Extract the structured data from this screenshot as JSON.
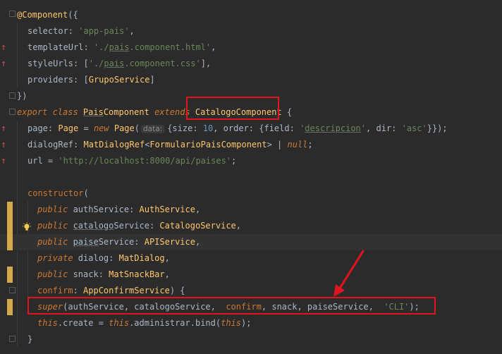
{
  "code_lines": [
    {
      "id": "l1",
      "segments": [
        {
          "text": "@Component",
          "cls": "t"
        },
        {
          "text": "({",
          "cls": ""
        }
      ]
    },
    {
      "id": "l2",
      "segments": [
        {
          "text": "selector",
          "cls": ""
        },
        {
          "text": ": ",
          "cls": ""
        },
        {
          "text": "'app-pais'",
          "cls": "s"
        },
        {
          "text": ",",
          "cls": ""
        }
      ]
    },
    {
      "id": "l3",
      "segments": [
        {
          "text": "templateUrl",
          "cls": ""
        },
        {
          "text": ": ",
          "cls": ""
        },
        {
          "text": "'./",
          "cls": "s"
        },
        {
          "text": "pais",
          "cls": "s ul"
        },
        {
          "text": ".component.html'",
          "cls": "s"
        },
        {
          "text": ",",
          "cls": ""
        }
      ]
    },
    {
      "id": "l4",
      "segments": [
        {
          "text": "styleUrls",
          "cls": ""
        },
        {
          "text": ": [",
          "cls": ""
        },
        {
          "text": "'./",
          "cls": "s"
        },
        {
          "text": "pais",
          "cls": "s ul"
        },
        {
          "text": ".component.css'",
          "cls": "s"
        },
        {
          "text": "],",
          "cls": ""
        }
      ]
    },
    {
      "id": "l5",
      "segments": [
        {
          "text": "providers",
          "cls": ""
        },
        {
          "text": ": [",
          "cls": ""
        },
        {
          "text": "GrupoService",
          "cls": "t"
        },
        {
          "text": "]",
          "cls": ""
        }
      ]
    },
    {
      "id": "l6",
      "segments": [
        {
          "text": "})",
          "cls": ""
        }
      ]
    },
    {
      "id": "l7",
      "segments": [
        {
          "text": "export class ",
          "cls": "ki"
        },
        {
          "text": "Pais",
          "cls": "t ul"
        },
        {
          "text": "Component ",
          "cls": "t"
        },
        {
          "text": "extends ",
          "cls": "ki"
        },
        {
          "text": "CatalogoComponent",
          "cls": "t"
        },
        {
          "text": " {",
          "cls": ""
        }
      ]
    },
    {
      "id": "l8",
      "segments": [
        {
          "text": "page",
          "cls": ""
        },
        {
          "text": ": ",
          "cls": ""
        },
        {
          "text": "Page",
          "cls": "t"
        },
        {
          "text": " = ",
          "cls": ""
        },
        {
          "text": "new ",
          "cls": "ki"
        },
        {
          "text": "Page",
          "cls": "t"
        },
        {
          "text": "(",
          "cls": ""
        },
        {
          "text": "data:",
          "cls": "hint"
        },
        {
          "text": "{size: ",
          "cls": ""
        },
        {
          "text": "10",
          "cls": "n"
        },
        {
          "text": ", order: {field: ",
          "cls": ""
        },
        {
          "text": "'",
          "cls": "s"
        },
        {
          "text": "descripcion",
          "cls": "s ul"
        },
        {
          "text": "'",
          "cls": "s"
        },
        {
          "text": ", dir: ",
          "cls": ""
        },
        {
          "text": "'asc'",
          "cls": "s"
        },
        {
          "text": "}});",
          "cls": ""
        }
      ]
    },
    {
      "id": "l9",
      "segments": [
        {
          "text": "dialogRef",
          "cls": ""
        },
        {
          "text": ": ",
          "cls": ""
        },
        {
          "text": "MatDialogRef",
          "cls": "t"
        },
        {
          "text": "<",
          "cls": ""
        },
        {
          "text": "FormularioPaisComponent",
          "cls": "t"
        },
        {
          "text": "> | ",
          "cls": ""
        },
        {
          "text": "null",
          "cls": "ki"
        },
        {
          "text": ";",
          "cls": ""
        }
      ]
    },
    {
      "id": "l10",
      "segments": [
        {
          "text": "url",
          "cls": ""
        },
        {
          "text": " = ",
          "cls": ""
        },
        {
          "text": "'http://localhost:8000/api/paises'",
          "cls": "s"
        },
        {
          "text": ";",
          "cls": ""
        }
      ]
    },
    {
      "id": "l11",
      "segments": []
    },
    {
      "id": "l12",
      "segments": [
        {
          "text": "constructor",
          "cls": "k"
        },
        {
          "text": "(",
          "cls": ""
        }
      ]
    },
    {
      "id": "l13",
      "segments": [
        {
          "text": "public ",
          "cls": "ki"
        },
        {
          "text": "authService",
          "cls": ""
        },
        {
          "text": ": ",
          "cls": ""
        },
        {
          "text": "AuthService",
          "cls": "t"
        },
        {
          "text": ",",
          "cls": ""
        }
      ]
    },
    {
      "id": "l14",
      "segments": [
        {
          "text": "public ",
          "cls": "ki"
        },
        {
          "text": "catalogo",
          "cls": "ul"
        },
        {
          "text": "Service",
          "cls": ""
        },
        {
          "text": ": ",
          "cls": ""
        },
        {
          "text": "CatalogoService",
          "cls": "t"
        },
        {
          "text": ",",
          "cls": ""
        }
      ]
    },
    {
      "id": "l15",
      "segments": [
        {
          "text": "public ",
          "cls": "ki"
        },
        {
          "text": "paise",
          "cls": "ul"
        },
        {
          "text": "Service",
          "cls": ""
        },
        {
          "text": ": ",
          "cls": ""
        },
        {
          "text": "APIService",
          "cls": "t"
        },
        {
          "text": ",",
          "cls": ""
        }
      ]
    },
    {
      "id": "l16",
      "segments": [
        {
          "text": "private ",
          "cls": "ki"
        },
        {
          "text": "dialog",
          "cls": ""
        },
        {
          "text": ": ",
          "cls": ""
        },
        {
          "text": "MatDialog",
          "cls": "t"
        },
        {
          "text": ",",
          "cls": ""
        }
      ]
    },
    {
      "id": "l17",
      "segments": [
        {
          "text": "public ",
          "cls": "ki"
        },
        {
          "text": "snack",
          "cls": ""
        },
        {
          "text": ": ",
          "cls": ""
        },
        {
          "text": "MatSnackBar",
          "cls": "t"
        },
        {
          "text": ",",
          "cls": ""
        }
      ]
    },
    {
      "id": "l18",
      "segments": [
        {
          "text": "confirm",
          "cls": "k"
        },
        {
          "text": ": ",
          "cls": ""
        },
        {
          "text": "AppConfirmService",
          "cls": "t"
        },
        {
          "text": ") {",
          "cls": ""
        }
      ]
    },
    {
      "id": "l19",
      "segments": [
        {
          "text": "super",
          "cls": "ki"
        },
        {
          "text": "(authService, catalogoService,  ",
          "cls": ""
        },
        {
          "text": "confirm",
          "cls": "k"
        },
        {
          "text": ", snack, paiseService,  ",
          "cls": ""
        },
        {
          "text": "'CLI'",
          "cls": "s"
        },
        {
          "text": ");",
          "cls": ""
        }
      ]
    },
    {
      "id": "l20",
      "segments": [
        {
          "text": "this",
          "cls": "ki"
        },
        {
          "text": ".create = ",
          "cls": ""
        },
        {
          "text": "this",
          "cls": "ki"
        },
        {
          "text": ".administrar.bind(",
          "cls": ""
        },
        {
          "text": "this",
          "cls": "ki"
        },
        {
          "text": ");",
          "cls": ""
        }
      ]
    },
    {
      "id": "l21",
      "segments": [
        {
          "text": "}",
          "cls": ""
        }
      ]
    }
  ],
  "colors": {
    "background": "#2b2b2b",
    "keyword": "#cc7832",
    "string": "#6a8759",
    "number": "#6897bb",
    "type": "#ffc66d",
    "annotation_red": "#e0141e",
    "modified_marker": "#d4a94a"
  },
  "gutter_icons": [
    "override-arrow-icon",
    "modified-marker",
    "fold-icon",
    "lightbulb-icon"
  ]
}
